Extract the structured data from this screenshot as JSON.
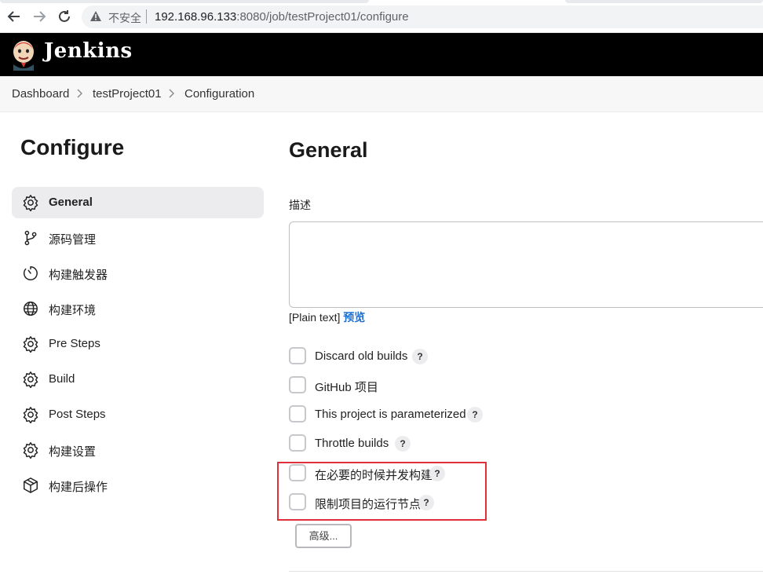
{
  "browser": {
    "insecure_label": "不安全",
    "url_host": "192.168.96.133",
    "url_rest": ":8080/job/testProject01/configure"
  },
  "header": {
    "title": "Jenkins"
  },
  "breadcrumb": [
    "Dashboard",
    "testProject01",
    "Configuration"
  ],
  "sidebar": {
    "title": "Configure",
    "items": [
      {
        "label": "General",
        "icon": "gear-icon",
        "active": true
      },
      {
        "label": "源码管理",
        "icon": "branch-icon"
      },
      {
        "label": "构建触发器",
        "icon": "timer-icon"
      },
      {
        "label": "构建环境",
        "icon": "globe-icon"
      },
      {
        "label": "Pre Steps",
        "icon": "gear-icon"
      },
      {
        "label": "Build",
        "icon": "gear-icon"
      },
      {
        "label": "Post Steps",
        "icon": "gear-icon"
      },
      {
        "label": "构建设置",
        "icon": "gear-icon"
      },
      {
        "label": "构建后操作",
        "icon": "package-icon"
      }
    ]
  },
  "main": {
    "section_title": "General",
    "description_label": "描述",
    "description_value": "",
    "plain_text": "[Plain text]",
    "preview_link": "预览",
    "options": [
      {
        "label": "Discard old builds",
        "checked": false,
        "help": "?"
      },
      {
        "label": "GitHub 项目",
        "checked": false
      },
      {
        "label": "This project is parameterized",
        "checked": false,
        "help": "?"
      },
      {
        "label": "Throttle builds",
        "checked": false,
        "help": "?"
      },
      {
        "label": "在必要的时候并发构建",
        "checked": false,
        "help": "?"
      },
      {
        "label": "限制项目的运行节点",
        "checked": false,
        "help": "?"
      }
    ],
    "advanced_button": "高级..."
  },
  "colors": {
    "highlight": "#e0313a",
    "link": "#1f6fd0",
    "header_bg": "#000000"
  }
}
